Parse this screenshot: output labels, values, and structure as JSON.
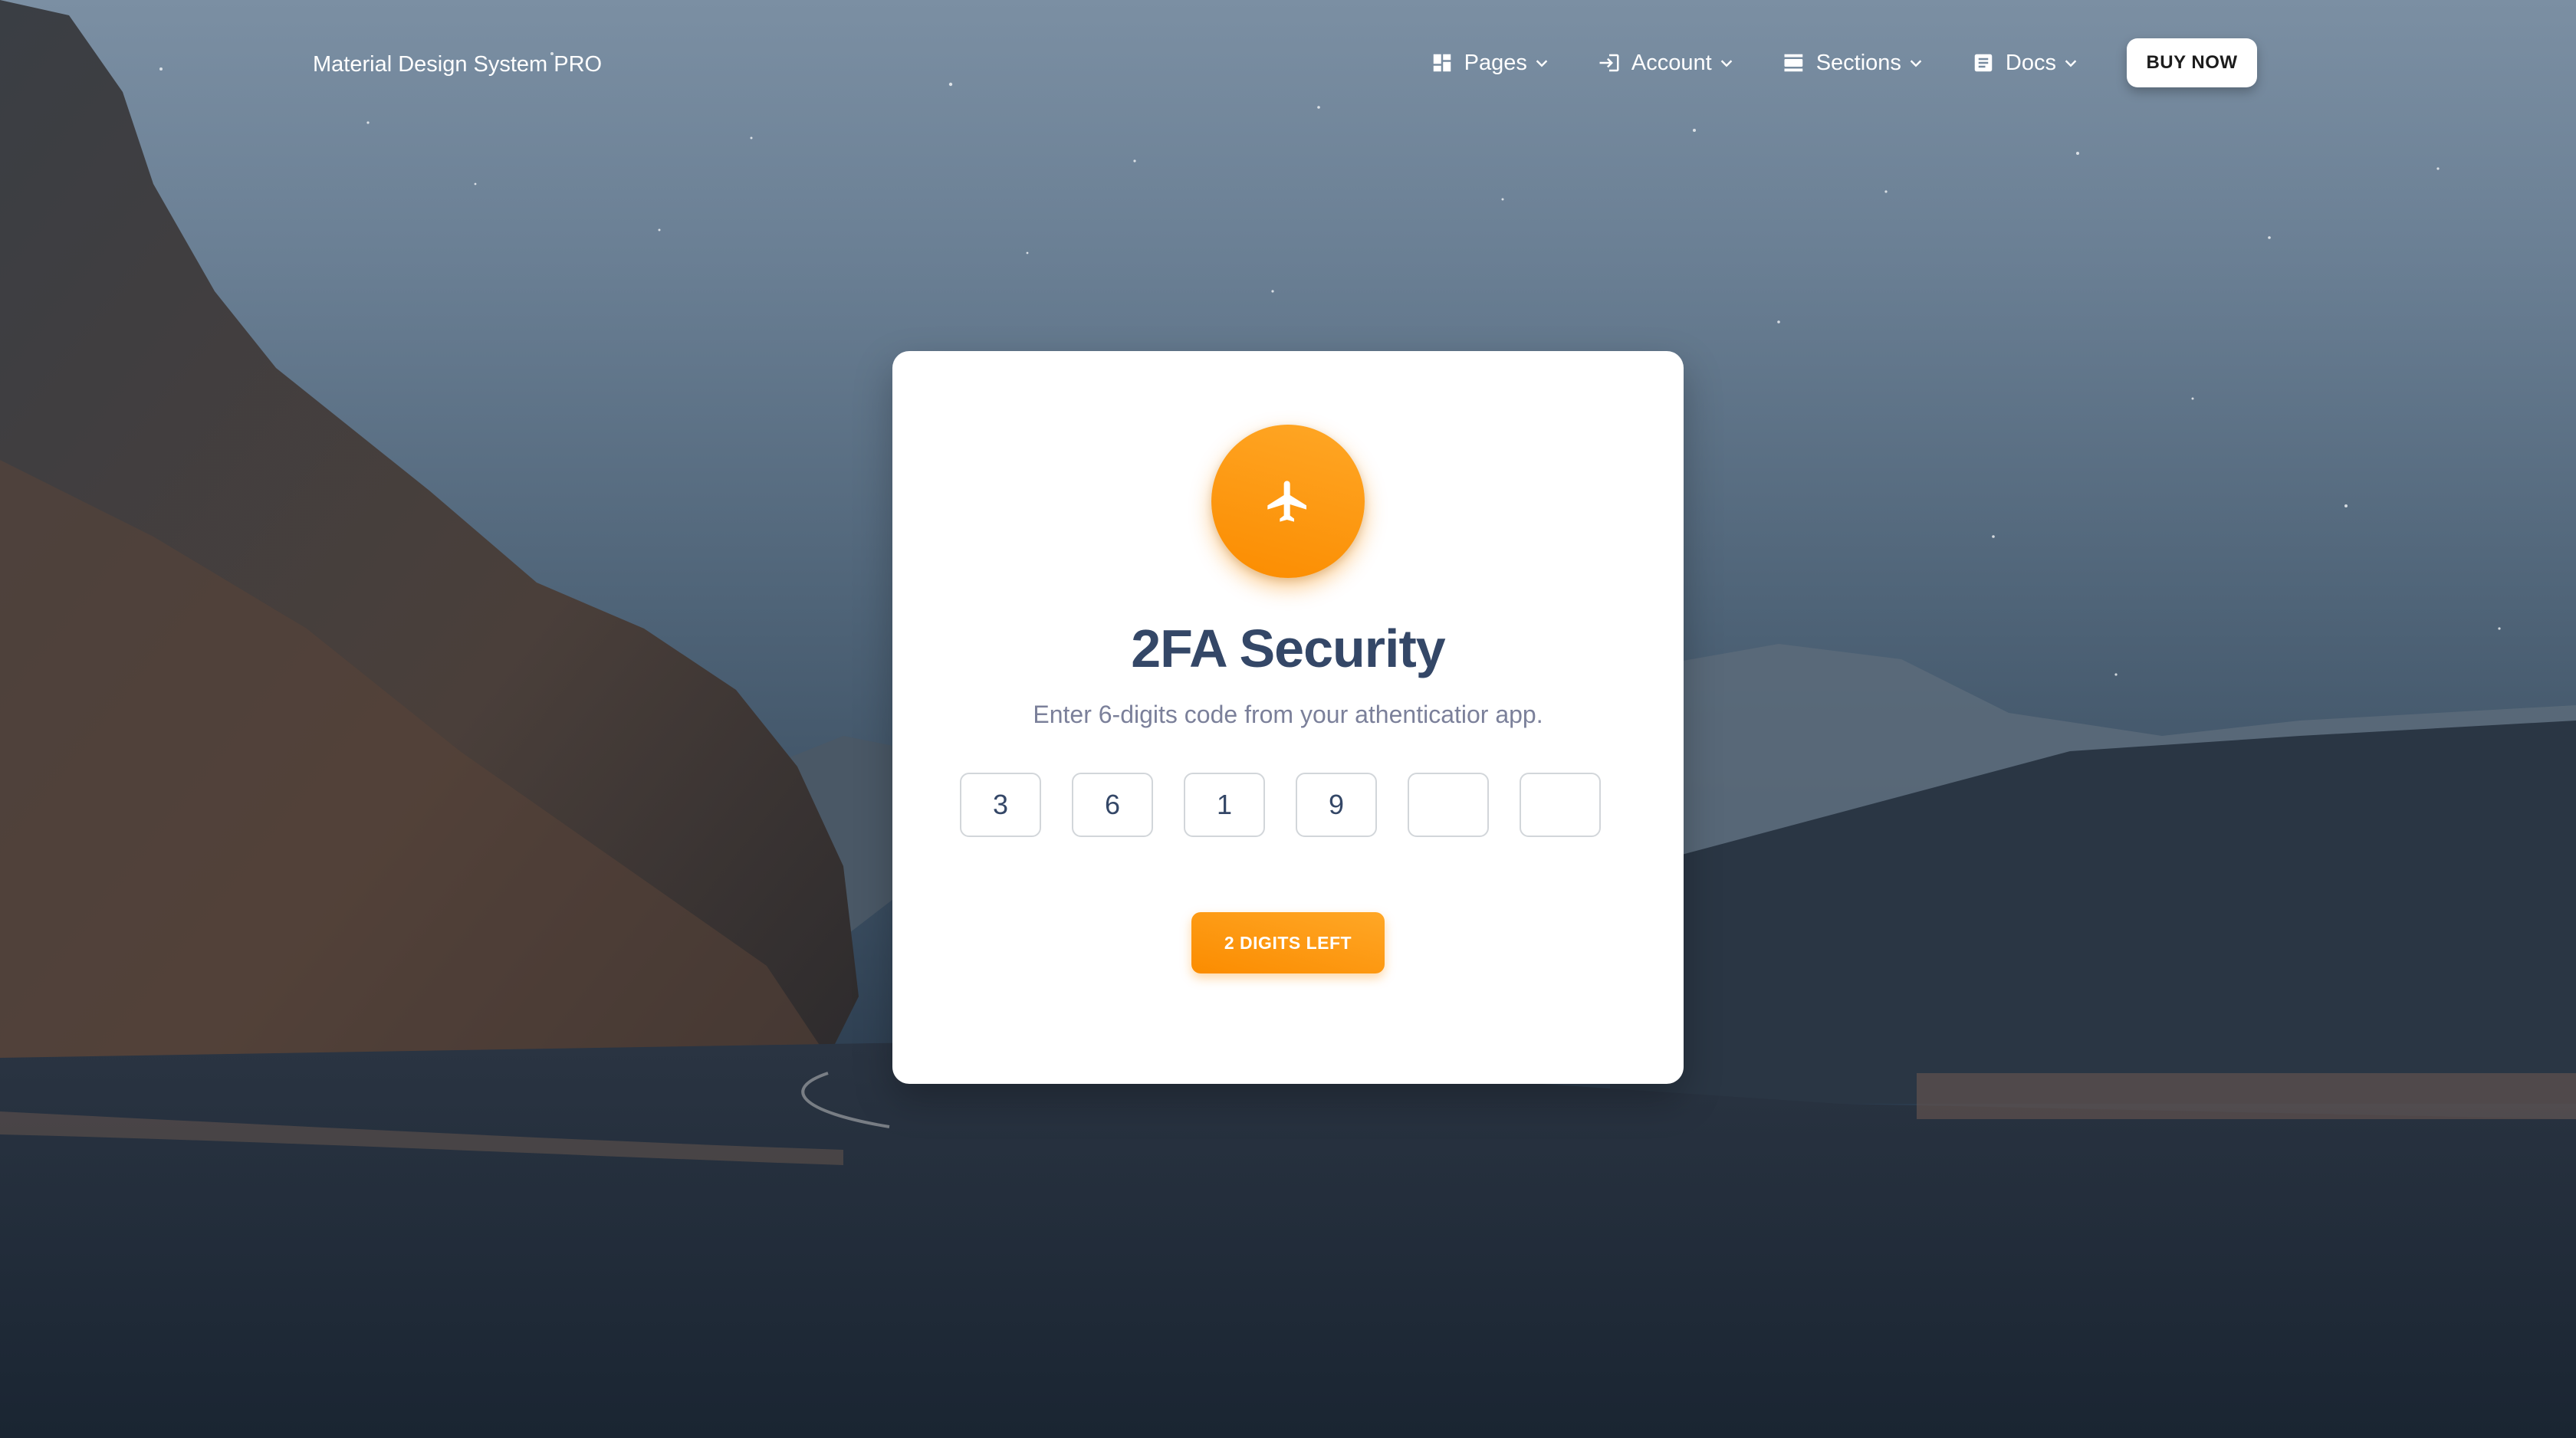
{
  "navbar": {
    "brand": "Material Design System PRO",
    "items": [
      {
        "label": "Pages",
        "icon": "dashboard-icon"
      },
      {
        "label": "Account",
        "icon": "login-icon"
      },
      {
        "label": "Sections",
        "icon": "view-day-icon"
      },
      {
        "label": "Docs",
        "icon": "article-icon"
      }
    ],
    "buy_button": "BUY NOW"
  },
  "card": {
    "icon": "airplane-icon",
    "title": "2FA Security",
    "subtitle": "Enter 6-digits code from your athenticatior app.",
    "digits": [
      "3",
      "6",
      "1",
      "9",
      "",
      ""
    ],
    "button": "2 DIGITS LEFT"
  },
  "colors": {
    "accent": "#fb8c00",
    "accent_light": "#ffa726",
    "title": "#344767",
    "subtitle": "#7b809a"
  }
}
